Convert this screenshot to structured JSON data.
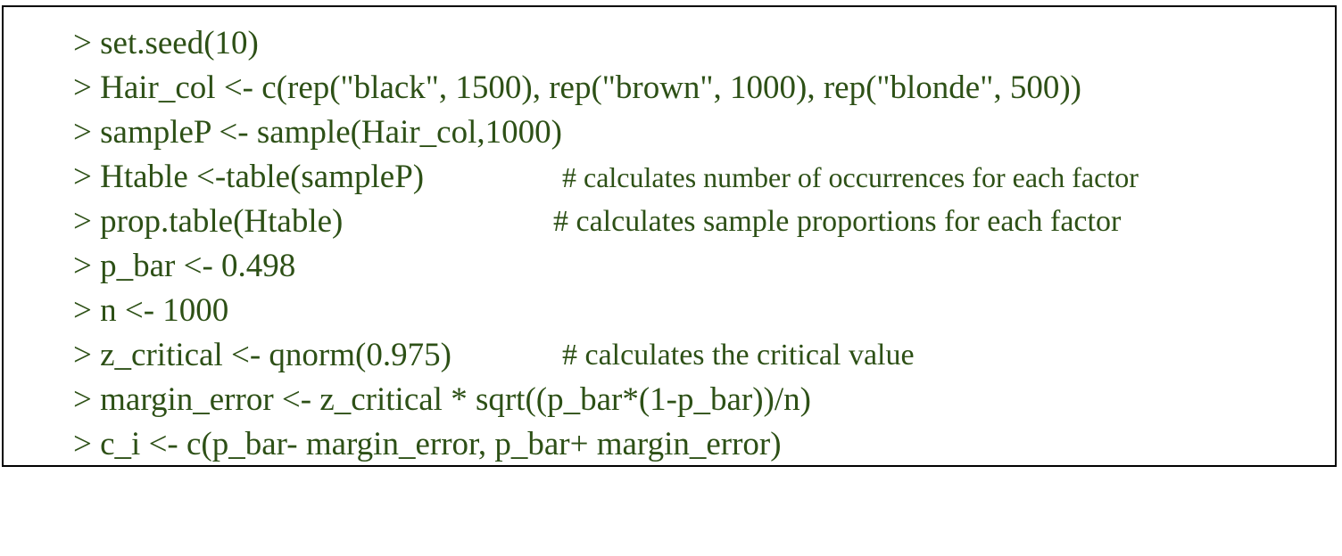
{
  "lines": [
    {
      "code": "> set.seed(10)",
      "comment": ""
    },
    {
      "code": "> Hair_col <- c(rep(\"black\", 1500), rep(\"brown\", 1000), rep(\"blonde\", 500))",
      "comment": ""
    },
    {
      "code": "> sampleP <- sample(Hair_col,1000)",
      "comment": ""
    },
    {
      "code": "> Htable <-table(sampleP)",
      "comment": "# calculates number of occurrences for each factor"
    },
    {
      "code": "> prop.table(Htable)",
      "comment": "# calculates sample proportions for each factor"
    },
    {
      "code": "> p_bar <- 0.498",
      "comment": ""
    },
    {
      "code": "> n <- 1000",
      "comment": ""
    },
    {
      "code": "> z_critical <- qnorm(0.975)",
      "comment": "# calculates the critical value"
    },
    {
      "code": "> margin_error <- z_critical * sqrt((p_bar*(1-p_bar))/n)",
      "comment": ""
    },
    {
      "code": "> c_i <- c(p_bar- margin_error, p_bar+ margin_error)",
      "comment": ""
    }
  ],
  "colors": {
    "text": "#2d5016",
    "border": "#000000",
    "background": "#ffffff"
  }
}
